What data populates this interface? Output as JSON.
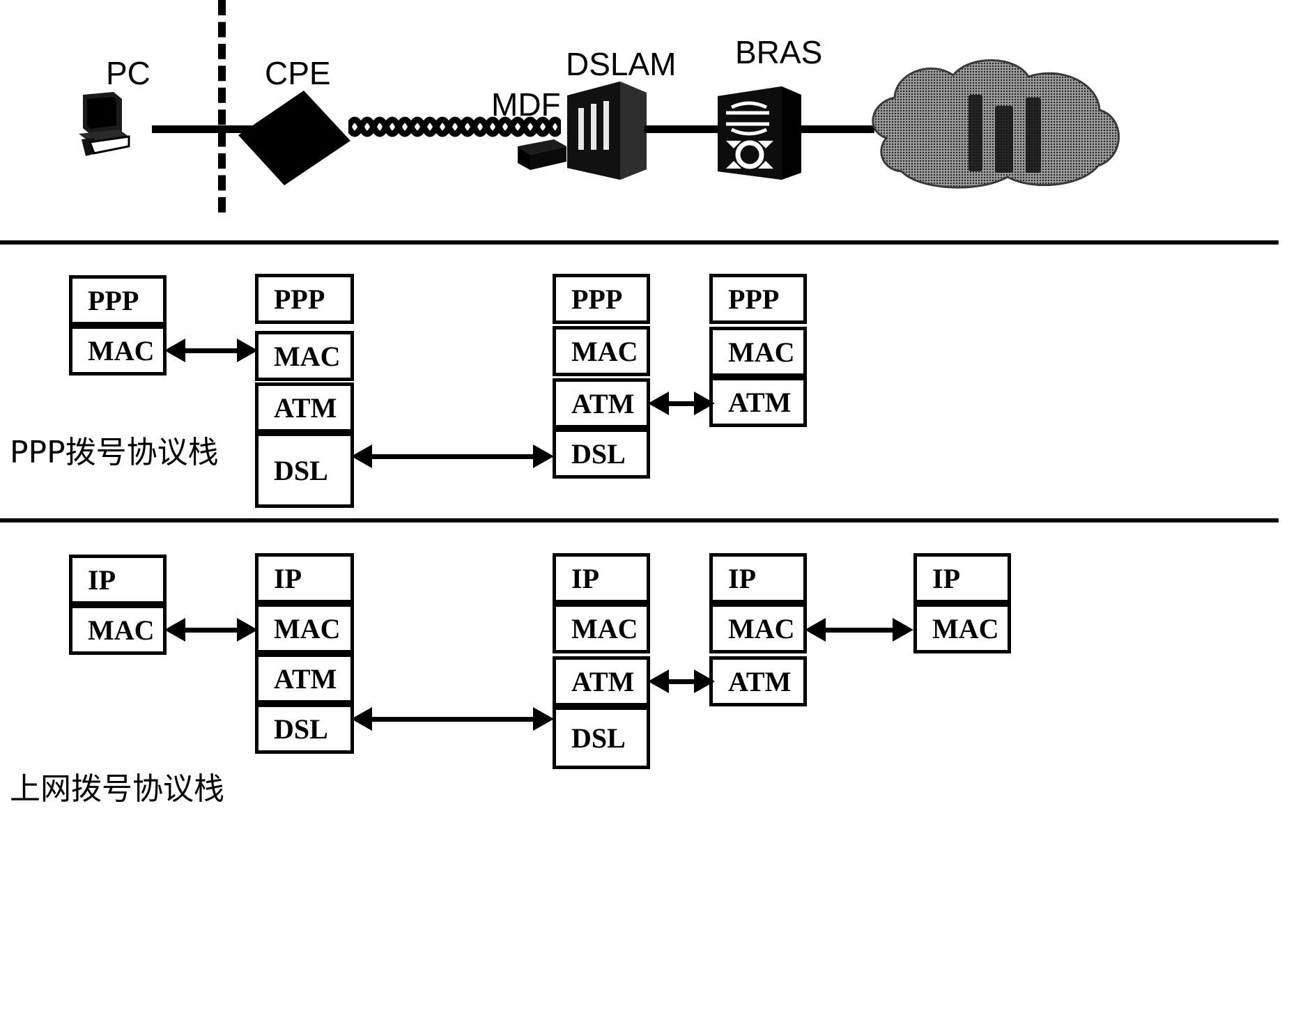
{
  "topology": {
    "nodes": [
      {
        "id": "pc",
        "label": "PC",
        "icon": "desktop-computer-icon"
      },
      {
        "id": "cpe",
        "label": "CPE",
        "icon": "modem-box-icon"
      },
      {
        "id": "mdf",
        "label": "MDF",
        "icon": "small-box-icon"
      },
      {
        "id": "dslam",
        "label": "DSLAM",
        "icon": "rack-cabinet-icon"
      },
      {
        "id": "bras",
        "label": "BRAS",
        "icon": "router-icon"
      },
      {
        "id": "cloud",
        "label": "",
        "icon": "network-cloud-icon"
      }
    ],
    "divider": "dashed-demarcation-line",
    "link_twisted_pair": "twisted-pair-cable"
  },
  "sections": [
    {
      "id": "ppp-stack",
      "caption": "PPP拨号协议栈",
      "columns": [
        {
          "id": "pc",
          "layers": [
            "PPP",
            "MAC"
          ]
        },
        {
          "id": "cpe",
          "layers": [
            "PPP",
            "MAC",
            "ATM",
            "DSL"
          ]
        },
        {
          "id": "dslam",
          "layers": [
            "PPP",
            "MAC",
            "ATM",
            "DSL"
          ]
        },
        {
          "id": "bras",
          "layers": [
            "PPP",
            "MAC",
            "ATM"
          ]
        }
      ],
      "arrows": [
        {
          "id": "pc-cpe-mac",
          "layer": "MAC",
          "from": "pc",
          "to": "cpe",
          "style": "double"
        },
        {
          "id": "cpe-dslam-dsl",
          "layer": "DSL",
          "from": "cpe",
          "to": "dslam",
          "style": "double"
        },
        {
          "id": "dslam-bras-atm",
          "layer": "ATM",
          "from": "dslam",
          "to": "bras",
          "style": "double"
        }
      ]
    },
    {
      "id": "ip-stack",
      "caption": "上网拨号协议栈",
      "columns": [
        {
          "id": "pc",
          "layers": [
            "IP",
            "MAC"
          ]
        },
        {
          "id": "cpe",
          "layers": [
            "IP",
            "MAC",
            "ATM",
            "DSL"
          ]
        },
        {
          "id": "dslam",
          "layers": [
            "IP",
            "MAC",
            "ATM",
            "DSL"
          ]
        },
        {
          "id": "bras",
          "layers": [
            "IP",
            "MAC",
            "ATM"
          ]
        },
        {
          "id": "far",
          "layers": [
            "IP",
            "MAC"
          ]
        }
      ],
      "arrows": [
        {
          "id": "pc-cpe-mac",
          "layer": "MAC",
          "from": "pc",
          "to": "cpe",
          "style": "double"
        },
        {
          "id": "cpe-dslam-dsl",
          "layer": "DSL",
          "from": "cpe",
          "to": "dslam",
          "style": "double"
        },
        {
          "id": "dslam-bras-atm",
          "layer": "ATM",
          "from": "dslam",
          "to": "bras",
          "style": "double"
        },
        {
          "id": "bras-far-mac",
          "layer": "MAC",
          "from": "bras",
          "to": "far",
          "style": "double"
        }
      ]
    }
  ],
  "colors": {
    "ink": "#000000",
    "paper": "#ffffff"
  }
}
